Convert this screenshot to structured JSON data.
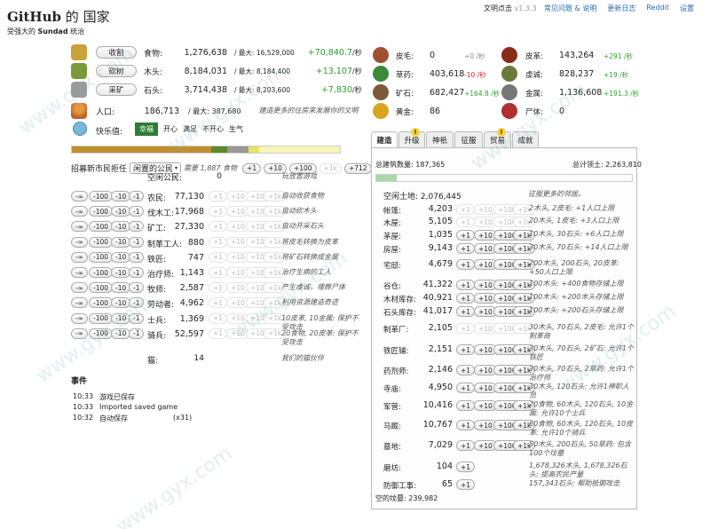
{
  "header": {
    "title": "GitHub",
    "title_suffix": "的 国家",
    "subtitle_prefix": "受强大的",
    "ruler": "Sundad",
    "subtitle_suffix": "统治",
    "version_prefix": "文明点击",
    "version": "v1.3.3",
    "links": [
      "常见问题 & 说明",
      "更新日志",
      "Reddit",
      "设置"
    ]
  },
  "basic_resources": [
    {
      "action": "收割",
      "name": "食物:",
      "amount": "1,276,638",
      "max": "/ 最大: 16,529,000",
      "rate": "+70,840.7",
      "unit": "/秒",
      "icon": "wheat-icon",
      "color": "#c9a23a"
    },
    {
      "action": "砍树",
      "name": "木头:",
      "amount": "8,184,031",
      "max": "/ 最大: 8,184,400",
      "rate": "+13,107",
      "unit": "/秒",
      "icon": "tree-icon",
      "color": "#7a9a3a"
    },
    {
      "action": "采矿",
      "name": "石头:",
      "amount": "3,714,438",
      "max": "/ 最大: 8,203,600",
      "rate": "+7,830",
      "unit": "/秒",
      "icon": "stone-icon",
      "color": "#9a9a9a"
    }
  ],
  "population": {
    "label": "人口:",
    "value": "186,713",
    "max": "/ 最大: 387,680",
    "note": "建造更多的住房来发展你的文明"
  },
  "happiness": {
    "label": "快乐值:",
    "levels": [
      "幸福",
      "开心",
      "满足",
      "不开心",
      "生气"
    ],
    "active": 0
  },
  "special_resources": [
    {
      "name": "皮毛:",
      "value": "0",
      "rate": "+0 /秒",
      "rate_class": "muted",
      "icon": "skins-icon",
      "color": "#a05030"
    },
    {
      "name": "草药:",
      "value": "403,618",
      "rate": "-10 /秒",
      "rate_class": "red",
      "icon": "herbs-icon",
      "color": "#3a8a3a"
    },
    {
      "name": "矿石:",
      "value": "682,427",
      "rate": "+164.8 /秒",
      "rate_class": "green",
      "icon": "ore-icon",
      "color": "#7a5a3a"
    },
    {
      "name": "黄金:",
      "value": "86",
      "rate": "",
      "rate_class": "muted",
      "icon": "gold-icon",
      "color": "#d9a520"
    }
  ],
  "special_resources_2": [
    {
      "name": "皮革:",
      "value": "143,264",
      "rate": "+291 /秒",
      "rate_class": "green",
      "icon": "leather-icon",
      "color": "#8a2a1a"
    },
    {
      "name": "虔诚:",
      "value": "828,237",
      "rate": "+19 /秒",
      "rate_class": "green",
      "icon": "piety-icon",
      "color": "#6a7a3a"
    },
    {
      "name": "金属:",
      "value": "1,136,608",
      "rate": "+191.3 /秒",
      "rate_class": "green",
      "icon": "metal-icon",
      "color": "#777777"
    },
    {
      "name": "尸体:",
      "value": "0",
      "rate": "",
      "rate_class": "muted",
      "icon": "corpse-icon",
      "color": "#b03030"
    }
  ],
  "recruit": {
    "label": "招募新市民拒任",
    "select": "闲置的公民",
    "need": "需要 1,887 食物",
    "buttons": [
      "+1",
      "+10",
      "+100",
      "+1k",
      "+712"
    ],
    "idle_label": "空闲公民:",
    "idle_value": "0",
    "idle_note": "玩放置游戏"
  },
  "jobs": [
    {
      "name": "农民:",
      "value": "77,130",
      "note": "自动收获食物"
    },
    {
      "name": "伐木工:",
      "value": "17,968",
      "note": "自动砍木头"
    },
    {
      "name": "矿工:",
      "value": "27,330",
      "note": "自动开采石头"
    },
    {
      "name": "制革工人:",
      "value": "880",
      "note": "将皮毛转换为皮革"
    },
    {
      "name": "铁匠:",
      "value": "747",
      "note": "将矿石转换成金属"
    },
    {
      "name": "治疗师:",
      "value": "1,143",
      "note": "治疗生病的工人"
    },
    {
      "name": "牧师:",
      "value": "2,587",
      "note": "产生虔诚，埋葬尸体"
    },
    {
      "name": "劳动者:",
      "value": "4,962",
      "note": "利用资源建造奇迹"
    },
    {
      "name": "士兵:",
      "value": "1,369",
      "note": "10皮革, 10金属: 保护不受攻击"
    },
    {
      "name": "骑兵:",
      "value": "52,597",
      "note": "20食物, 20皮革: 保护不受攻击"
    }
  ],
  "cats": {
    "name": "猫:",
    "value": "14",
    "note": "我们的猫伙伴"
  },
  "job_buttons": [
    "-∞",
    "-100",
    "-10",
    "-1",
    "+1",
    "+10",
    "+100",
    "+1k"
  ],
  "events": {
    "title": "事件",
    "items": [
      {
        "time": "10:33",
        "text": "游戏已保存",
        "count": ""
      },
      {
        "time": "10:33",
        "text": "Imported saved game",
        "count": ""
      },
      {
        "time": "10:32",
        "text": "自动保存",
        "count": "(x31)"
      }
    ]
  },
  "tabs": [
    {
      "label": "建造",
      "alert": false
    },
    {
      "label": "升级",
      "alert": true
    },
    {
      "label": "神祇",
      "alert": false
    },
    {
      "label": "征服",
      "alert": false
    },
    {
      "label": "贸易",
      "alert": true
    },
    {
      "label": "成就",
      "alert": false
    }
  ],
  "buildings": {
    "total_label": "总建筑数量:",
    "total": "187,365",
    "land_label": "总计领土:",
    "land": "2,263,810",
    "free_land_label": "空闲土地:",
    "free_land": "2,076,445",
    "free_land_note": "征服更多的邻居。",
    "buttons": [
      "+1",
      "+10",
      "+100",
      "+1k"
    ],
    "items": [
      {
        "name": "帐篷:",
        "value": "4,203",
        "note": "2木头, 2皮毛: +1人口上限",
        "enabled": false,
        "btns": 4
      },
      {
        "name": "木屋:",
        "value": "5,105",
        "note": "20木头, 1皮毛: +3人口上限",
        "enabled": false,
        "btns": 4
      },
      {
        "name": "茅屋:",
        "value": "1,035",
        "note": "10木头, 30石头: +6人口上限",
        "enabled": true,
        "btns": 4
      },
      {
        "name": "房屋:",
        "value": "9,143",
        "note": "30木头, 70石头: +14人口上限",
        "enabled": true,
        "btns": 4
      },
      {
        "name": "宅邸:",
        "value": "4,679",
        "note": "200木头, 200石头, 20皮革: +50人口上限",
        "enabled": true,
        "btns": 4
      },
      {
        "name": "谷仓:",
        "value": "41,322",
        "note": "100木头: +400食物存储上限",
        "enabled": true,
        "btns": 4
      },
      {
        "name": "木材库存:",
        "value": "40,921",
        "note": "100木头: +200木头存储上限",
        "enabled": true,
        "btns": 4
      },
      {
        "name": "石头库存:",
        "value": "41,017",
        "note": "100木头: +200石头存储上限",
        "enabled": true,
        "btns": 4
      },
      {
        "name": "制革厂:",
        "value": "2,105",
        "note": "30木头, 70石头, 2皮毛: 允许1个制革商",
        "enabled": false,
        "btns": 4
      },
      {
        "name": "铁匠铺:",
        "value": "2,151",
        "note": "30木头, 70石头, 2矿石: 允许1个铁匠",
        "enabled": true,
        "btns": 4
      },
      {
        "name": "药剂师:",
        "value": "2,146",
        "note": "30木头, 70石头, 2草药: 允许1个治疗师",
        "enabled": true,
        "btns": 4
      },
      {
        "name": "寺庙:",
        "value": "4,950",
        "note": "30木头, 120石头: 允许1神职人员",
        "enabled": true,
        "btns": 4
      },
      {
        "name": "军营:",
        "value": "10,416",
        "note": "20食物, 60木头, 120石头, 10金属: 允许10个士兵",
        "enabled": true,
        "btns": 4
      },
      {
        "name": "马厩:",
        "value": "10,767",
        "note": "60食物, 60木头, 120石头, 10皮革: 允许10个骑兵",
        "enabled": true,
        "btns": 4
      },
      {
        "name": "墓地:",
        "value": "7,029",
        "note": "50木头, 200石头, 50草药: 包含100个坟墓",
        "enabled": true,
        "btns": 4
      },
      {
        "name": "磨坊:",
        "value": "104",
        "note": "1,678,326木头, 1,678,326石头: 提高农民产量",
        "enabled": true,
        "btns": 1
      },
      {
        "name": "防御工事:",
        "value": "65",
        "note": "157,343石头: 帮助抵御攻击",
        "enabled": true,
        "btns": 1
      }
    ],
    "vacant_label": "空的坟墓:",
    "vacant": "239,982"
  }
}
